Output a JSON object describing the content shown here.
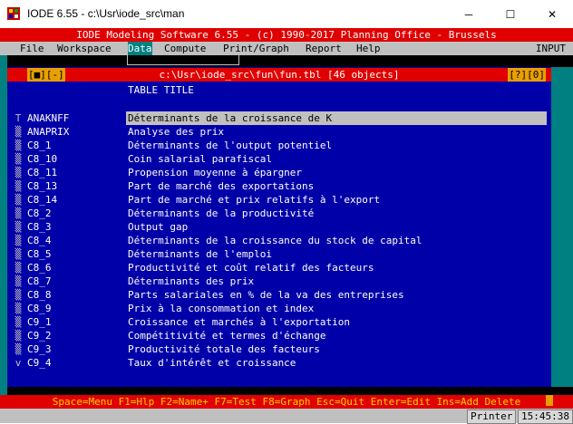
{
  "window": {
    "title": "IODE 6.55 - c:\\Usr\\iode_src\\man",
    "minimize": "─",
    "maximize": "☐",
    "close": "✕"
  },
  "banner": "IODE Modeling Software 6.55 - (c) 1990-2017 Planning Office - Brussels",
  "menu": {
    "items": [
      "File",
      "Workspace",
      "Data",
      "Compute",
      "Print/Graph",
      "Report",
      "Help"
    ],
    "selected": "Data",
    "mode": "INPUT"
  },
  "table_window": {
    "left_buttons": "[■][-]",
    "path": "c:\\Usr\\iode_src\\fun\\fun.tbl [46 objects]",
    "right_buttons": "[?][0]",
    "header": "TABLE TITLE",
    "rows": [
      {
        "mark": "T",
        "name": "ANAKNFF",
        "title": "Déterminants de la croissance de K"
      },
      {
        "mark": "▒",
        "name": "ANAPRIX",
        "title": "Analyse des prix"
      },
      {
        "mark": "▒",
        "name": "C8_1",
        "title": "Déterminants de l'output potentiel"
      },
      {
        "mark": "▒",
        "name": "C8_10",
        "title": "Coin salarial parafiscal"
      },
      {
        "mark": "▒",
        "name": "C8_11",
        "title": "Propension moyenne à épargner"
      },
      {
        "mark": "▒",
        "name": "C8_13",
        "title": "Part de marché des exportations"
      },
      {
        "mark": "▒",
        "name": "C8_14",
        "title": "Part de marché et prix relatifs à l'export"
      },
      {
        "mark": "▒",
        "name": "C8_2",
        "title": "Déterminants de la productivité"
      },
      {
        "mark": "▒",
        "name": "C8_3",
        "title": "Output gap"
      },
      {
        "mark": "▒",
        "name": "C8_4",
        "title": "Déterminants de la croissance du stock de capital"
      },
      {
        "mark": "▒",
        "name": "C8_5",
        "title": "Déterminants de l'emploi"
      },
      {
        "mark": "▒",
        "name": "C8_6",
        "title": "Productivité et coût relatif des facteurs"
      },
      {
        "mark": "▒",
        "name": "C8_7",
        "title": "Déterminants des prix"
      },
      {
        "mark": "▒",
        "name": "C8_8",
        "title": "Parts salariales en % de la va des entreprises"
      },
      {
        "mark": "▒",
        "name": "C8_9",
        "title": "Prix à la consommation et index"
      },
      {
        "mark": "▒",
        "name": "C9_1",
        "title": "Croissance et marchés à l'exportation"
      },
      {
        "mark": "▒",
        "name": "C9_2",
        "title": "Compétitivité et termes d'échange"
      },
      {
        "mark": "▒",
        "name": "C9_3",
        "title": "Productivité totale des facteurs"
      },
      {
        "mark": "v",
        "name": "C9_4",
        "title": "Taux d'intérêt et croissance"
      }
    ]
  },
  "status_bar": "Space=Menu F1=Hlp F2=Name+ F7=Test F8=Graph Esc=Quit Enter=Edit Ins=Add Delete",
  "bottom": {
    "printer": "Printer",
    "time": "15:45:38"
  },
  "colors": {
    "banner_red": "#e00000",
    "panel_blue": "#0000a8",
    "menu_gray": "#c0c0c0",
    "accent_cyan": "#008080",
    "status_yellow": "#ffd000"
  }
}
